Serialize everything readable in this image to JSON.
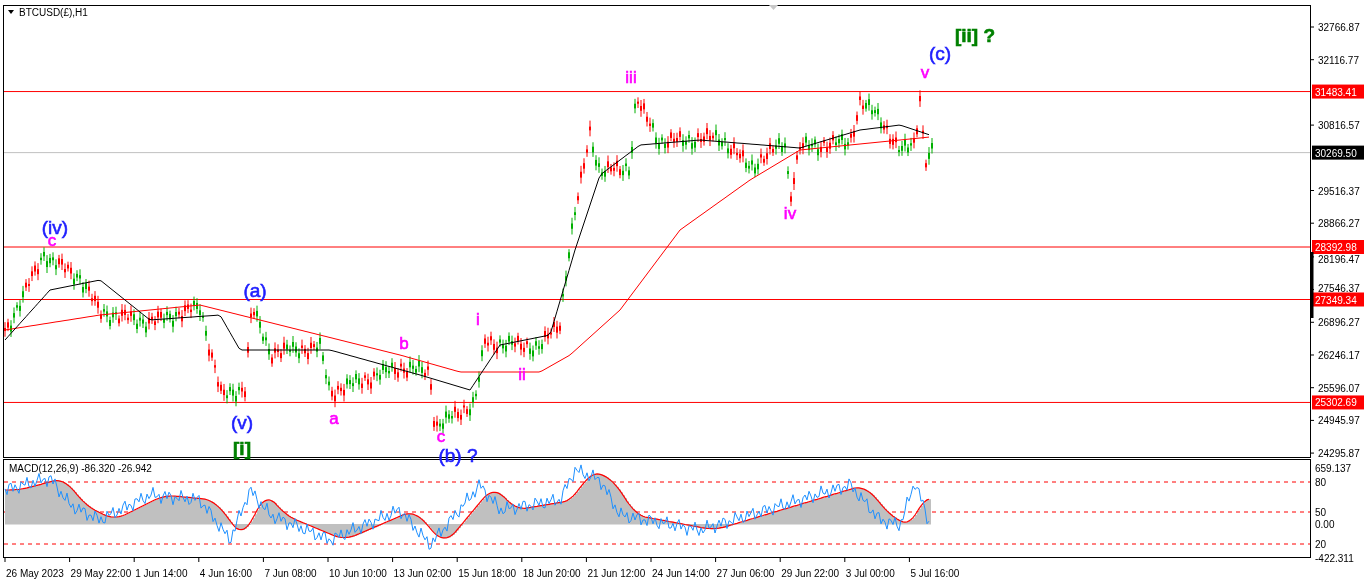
{
  "chart": {
    "title": "BTCUSD(£),H1",
    "price_ticks": [
      "32766.87",
      "32116.77",
      "30816.57",
      "29516.37",
      "28866.27",
      "28196.47",
      "27546.37",
      "26896.27",
      "26246.17",
      "25596.07",
      "24945.97",
      "24295.87"
    ],
    "levels": [
      {
        "price": "31483.41",
        "kind": "level"
      },
      {
        "price": "30269.50",
        "kind": "current"
      },
      {
        "price": "28392.98",
        "kind": "level"
      },
      {
        "price": "27349.34",
        "kind": "level"
      },
      {
        "price": "25302.69",
        "kind": "level"
      }
    ],
    "wave_labels": [
      {
        "text": "(iv)",
        "color": "#1e1eff"
      },
      {
        "text": "c",
        "color": "#ff00ff"
      },
      {
        "text": "(a)",
        "color": "#1e1eff"
      },
      {
        "text": "(v)",
        "color": "#1e1eff"
      },
      {
        "text": "[i]",
        "color": "#008000"
      },
      {
        "text": "a",
        "color": "#ff00ff"
      },
      {
        "text": "b",
        "color": "#ff00ff"
      },
      {
        "text": "c",
        "color": "#ff00ff"
      },
      {
        "text": "(b) ?",
        "color": "#1e1eff"
      },
      {
        "text": "i",
        "color": "#ff00ff"
      },
      {
        "text": "ii",
        "color": "#ff00ff"
      },
      {
        "text": "iii",
        "color": "#ff00ff"
      },
      {
        "text": "iv",
        "color": "#ff00ff"
      },
      {
        "text": "v",
        "color": "#ff00ff"
      },
      {
        "text": "(c)",
        "color": "#1e1eff"
      },
      {
        "text": "[ii] ?",
        "color": "#008000"
      }
    ]
  },
  "macd": {
    "title": "MACD(12,26,9) -86.320 -26.942",
    "ticks": [
      "659.137",
      "80",
      "50",
      "0.00",
      "20",
      "-422.311"
    ]
  },
  "time_axis": [
    "26 May 2023",
    "29 May 22:00",
    "1 Jun 14:00",
    "4 Jun 16:00",
    "7 Jun 08:00",
    "10 Jun 10:00",
    "13 Jun 02:00",
    "15 Jun 18:00",
    "18 Jun 20:00",
    "21 Jun 12:00",
    "24 Jun 14:00",
    "27 Jun 06:00",
    "29 Jun 22:00",
    "3 Jul 00:00",
    "5 Jul 16:00"
  ]
}
